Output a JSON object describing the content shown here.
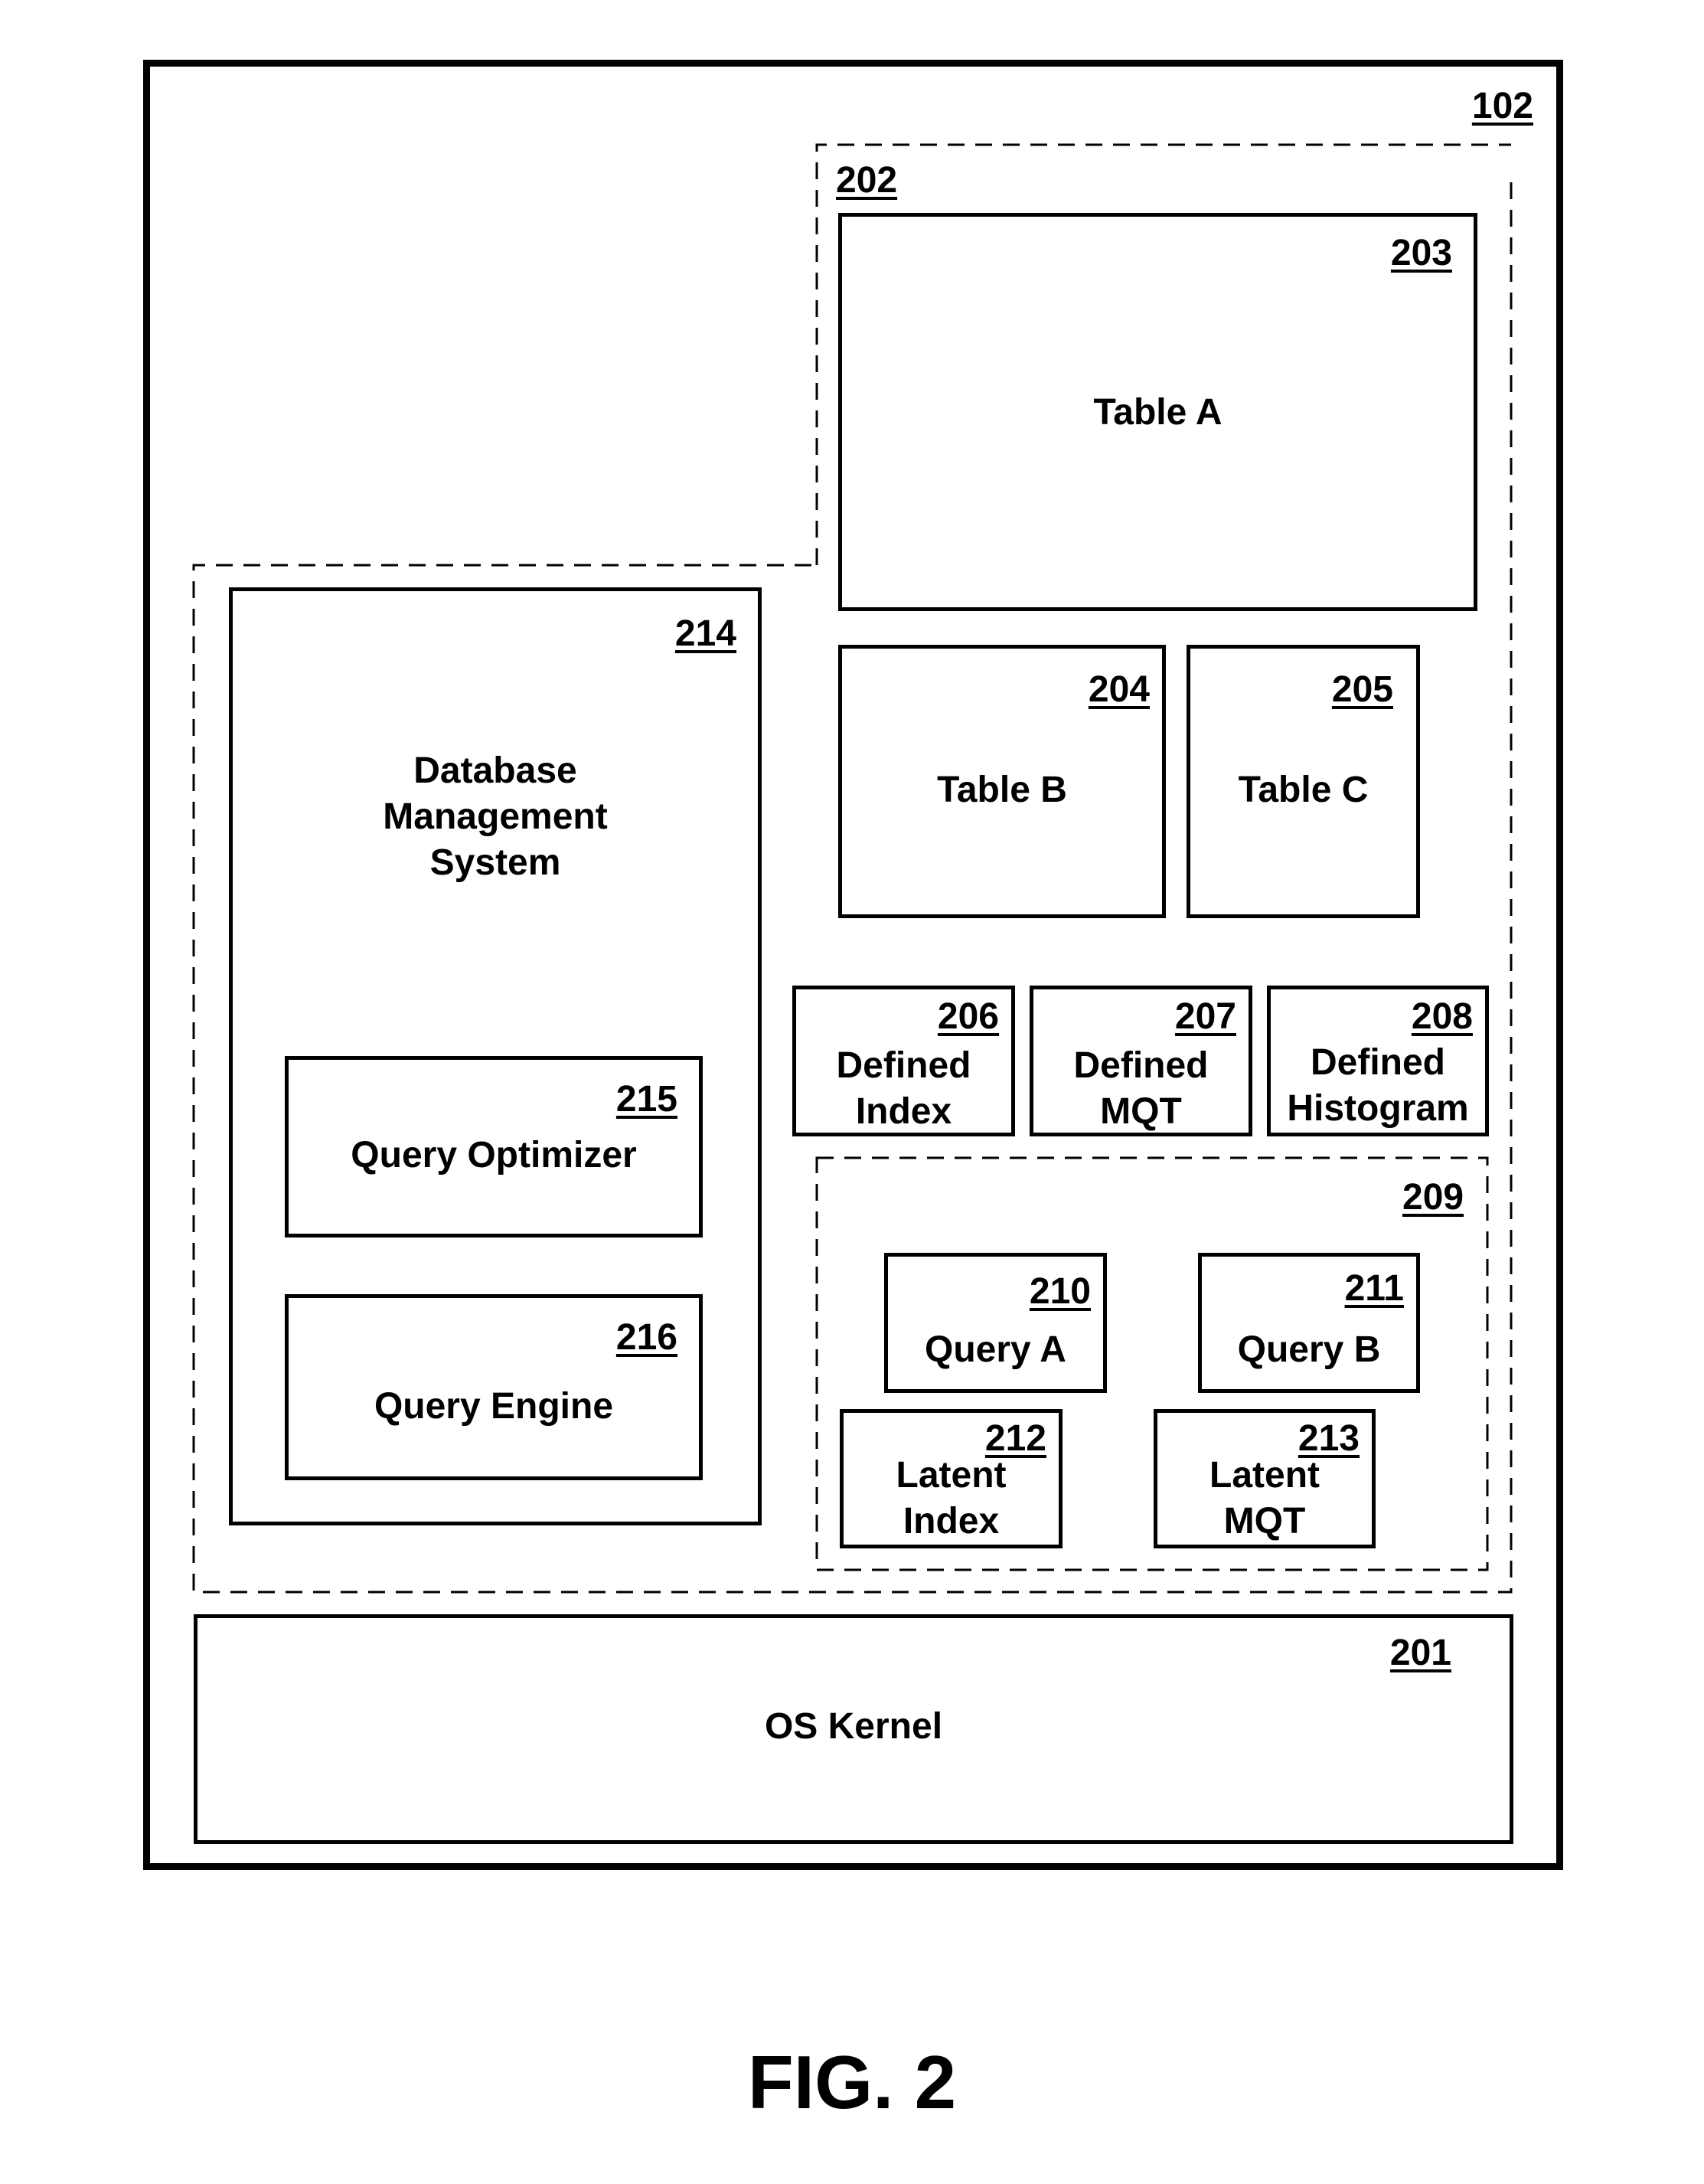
{
  "figure": {
    "caption": "FIG. 2",
    "system": {
      "ref": "102"
    },
    "storage_region": {
      "ref": "202"
    },
    "dbms": {
      "ref": "214",
      "label": "Database\nManagement\nSystem"
    },
    "query_optimizer": {
      "ref": "215",
      "label": "Query Optimizer"
    },
    "query_engine": {
      "ref": "216",
      "label": "Query Engine"
    },
    "table_a": {
      "ref": "203",
      "label": "Table A"
    },
    "table_b": {
      "ref": "204",
      "label": "Table B"
    },
    "table_c": {
      "ref": "205",
      "label": "Table C"
    },
    "defined_index": {
      "ref": "206",
      "label": "Defined\nIndex"
    },
    "defined_mqt": {
      "ref": "207",
      "label": "Defined\nMQT"
    },
    "defined_histogram": {
      "ref": "208",
      "label": "Defined\nHistogram"
    },
    "query_cache": {
      "ref": "209"
    },
    "query_a": {
      "ref": "210",
      "label": "Query A"
    },
    "query_b": {
      "ref": "211",
      "label": "Query B"
    },
    "latent_index": {
      "ref": "212",
      "label": "Latent\nIndex"
    },
    "latent_mqt": {
      "ref": "213",
      "label": "Latent\nMQT"
    },
    "os_kernel": {
      "ref": "201",
      "label": "OS Kernel"
    }
  }
}
